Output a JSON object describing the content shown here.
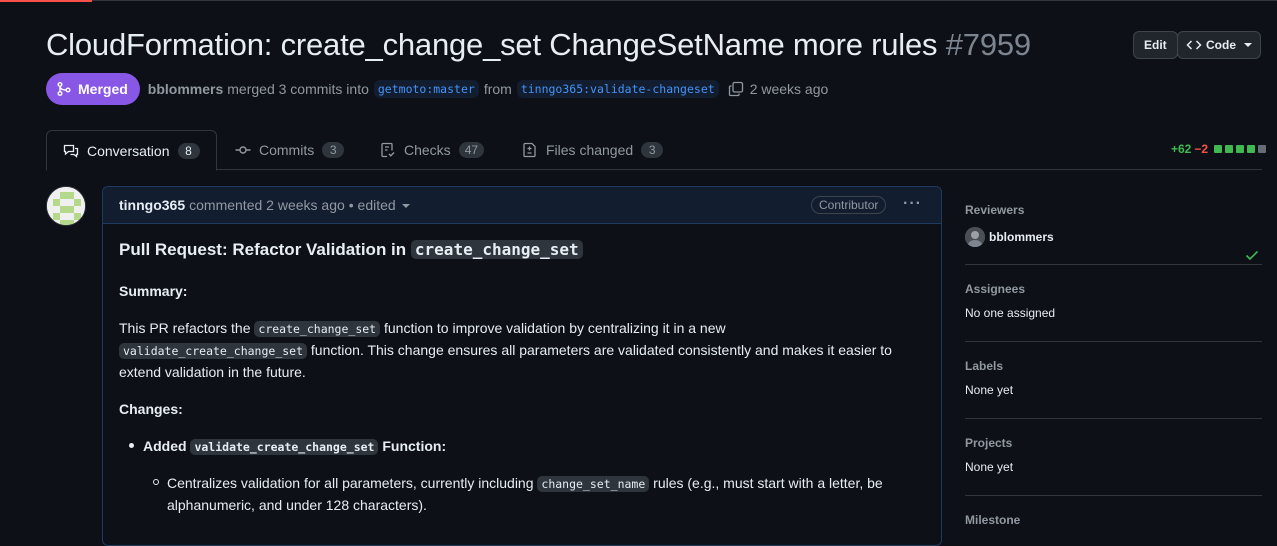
{
  "pr": {
    "title": "CloudFormation: create_change_set ChangeSetName more rules",
    "number": "#7959",
    "edit_label": "Edit",
    "code_label": "Code",
    "status": "Merged",
    "merger": "bblommers",
    "merge_text": "merged 3 commits into",
    "base_branch": "getmoto:master",
    "from_text": "from",
    "head_branch": "tinngo365:validate-changeset",
    "time": "2 weeks ago"
  },
  "tabs": [
    {
      "label": "Conversation",
      "count": "8",
      "icon": "comment-discussion-icon"
    },
    {
      "label": "Commits",
      "count": "3",
      "icon": "git-commit-icon"
    },
    {
      "label": "Checks",
      "count": "47",
      "icon": "checklist-icon"
    },
    {
      "label": "Files changed",
      "count": "3",
      "icon": "file-diff-icon"
    }
  ],
  "diffstat": {
    "additions": "+62",
    "deletions": "−2"
  },
  "comment": {
    "author": "tinngo365",
    "action": "commented 2 weeks ago",
    "edited": "• edited",
    "badge": "Contributor",
    "heading_prefix": "Pull Request: Refactor Validation in",
    "heading_code": "create_change_set",
    "summary_label": "Summary:",
    "p1_a": "This PR refactors the",
    "p1_code": "create_change_set",
    "p1_b": "function to improve validation by centralizing it in a new",
    "p2_code": "validate_create_change_set",
    "p2_b": "function. This change ensures all parameters are validated consistently and makes it easier to",
    "p3": "extend validation in the future.",
    "changes_label": "Changes:",
    "li1_a": "Added",
    "li1_code": "validate_create_change_set",
    "li1_b": "Function:",
    "li2_a": "Centralizes validation for all parameters, currently including",
    "li2_code": "change_set_name",
    "li2_b": "rules (e.g., must start with a letter, be",
    "li2_c": "alphanumeric, and under 128 characters)."
  },
  "sidebar": {
    "reviewers_title": "Reviewers",
    "reviewer": "bblommers",
    "assignees_title": "Assignees",
    "assignees_value": "No one assigned",
    "labels_title": "Labels",
    "labels_value": "None yet",
    "projects_title": "Projects",
    "projects_value": "None yet",
    "milestone_title": "Milestone"
  },
  "colors": {
    "merged": "#8957e5",
    "link": "#4493f8",
    "added": "#3fb950",
    "deleted": "#f85149",
    "bg": "#0d1117"
  }
}
